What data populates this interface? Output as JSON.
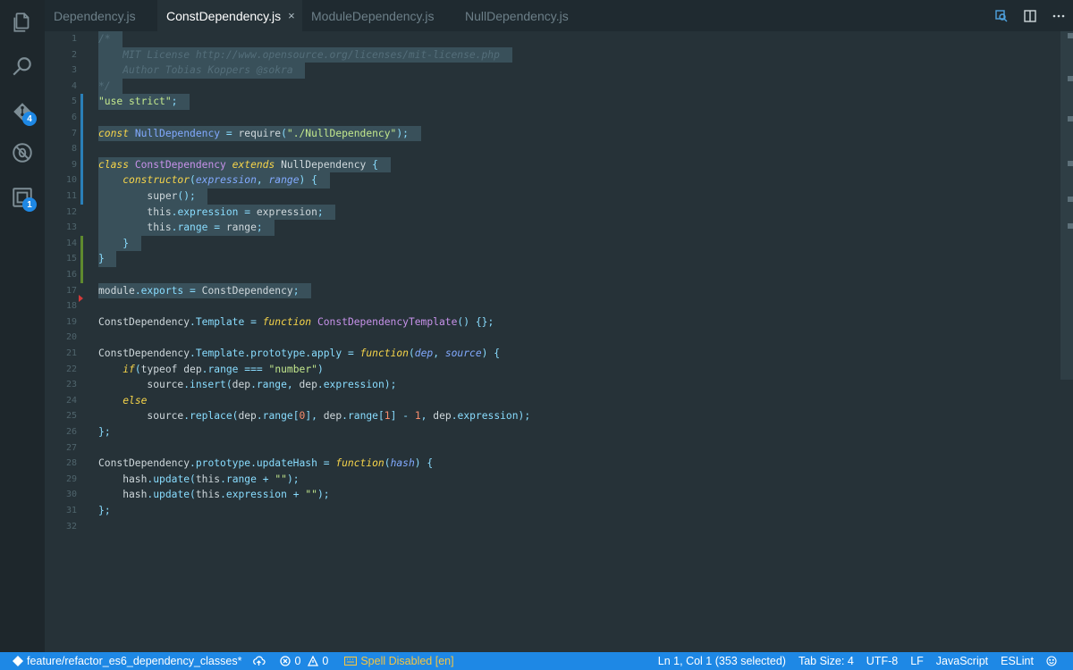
{
  "activity_bar": {
    "items": [
      {
        "name": "explorer-icon",
        "badge": ""
      },
      {
        "name": "search-icon",
        "badge": ""
      },
      {
        "name": "source-control-icon",
        "badge": "4"
      },
      {
        "name": "debug-icon",
        "badge": ""
      },
      {
        "name": "extensions-icon",
        "badge": "1"
      }
    ]
  },
  "tabs": [
    {
      "label": "Dependency.js",
      "active": false
    },
    {
      "label": "ConstDependency.js",
      "active": true
    },
    {
      "label": "ModuleDependency.js",
      "active": false
    },
    {
      "label": "NullDependency.js",
      "active": false
    }
  ],
  "tab_close_glyph": "×",
  "tab_actions": [
    "open-changes-icon",
    "split-editor-icon",
    "more-actions-icon"
  ],
  "editor": {
    "line_numbers": [
      "1",
      "2",
      "3",
      "4",
      "5",
      "6",
      "7",
      "8",
      "9",
      "10",
      "11",
      "12",
      "13",
      "14",
      "15",
      "16",
      "17",
      "18",
      "19",
      "20",
      "21",
      "22",
      "23",
      "24",
      "25",
      "26",
      "27",
      "28",
      "29",
      "30",
      "31",
      "32"
    ],
    "lines": [
      "/*",
      "    MIT License http://www.opensource.org/licenses/mit-license.php",
      "    Author Tobias Koppers @sokra",
      "*/",
      "\"use strict\";",
      "",
      "const NullDependency = require(\"./NullDependency\");",
      "",
      "class ConstDependency extends NullDependency {",
      "    constructor(expression, range) {",
      "        super();",
      "        this.expression = expression;",
      "        this.range = range;",
      "    }",
      "}",
      "",
      "module.exports = ConstDependency;",
      "",
      "ConstDependency.Template = function ConstDependencyTemplate() {};",
      "",
      "ConstDependency.Template.prototype.apply = function(dep, source) {",
      "    if(typeof dep.range === \"number\")",
      "        source.insert(dep.range, dep.expression);",
      "    else",
      "        source.replace(dep.range[0], dep.range[1] - 1, dep.expression);",
      "};",
      "",
      "ConstDependency.prototype.updateHash = function(hash) {",
      "    hash.update(this.range + \"\");",
      "    hash.update(this.expression + \"\");",
      "};",
      ""
    ]
  },
  "statusbar": {
    "branch": "feature/refactor_es6_dependency_classes*",
    "errors": "0",
    "warnings": "0",
    "spell": "Spell Disabled [en]",
    "position": "Ln 1, Col 1 (353 selected)",
    "tab_size": "Tab Size: 4",
    "encoding": "UTF-8",
    "eol": "LF",
    "language": "JavaScript",
    "linter": "ESLint"
  },
  "colors": {
    "accent": "#1e88e5",
    "editor_bg": "#263238",
    "selection": "#39505a"
  }
}
